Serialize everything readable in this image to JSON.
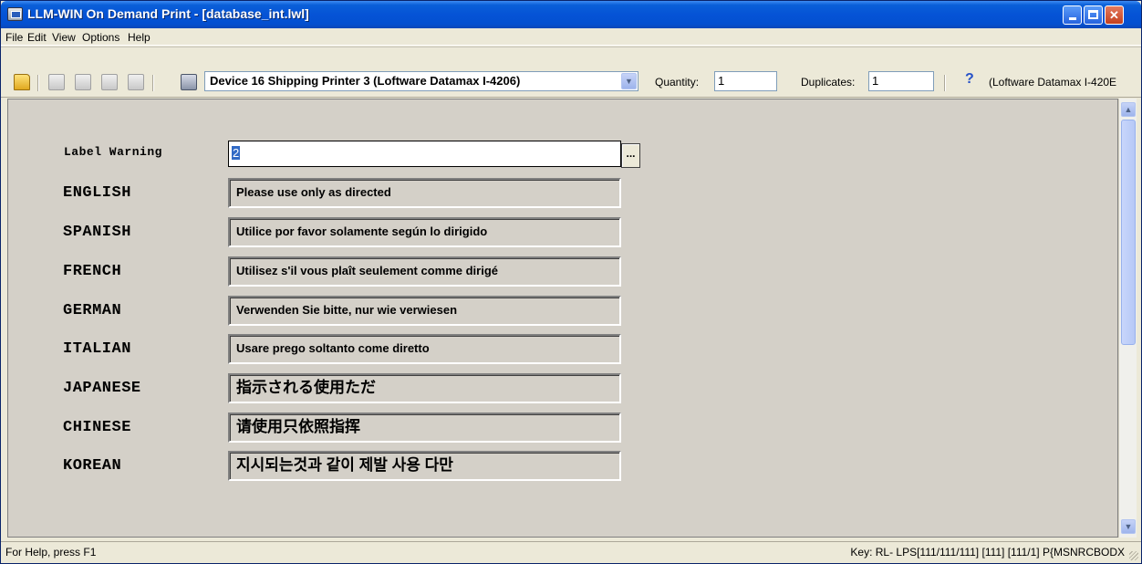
{
  "window": {
    "title": "LLM-WIN On Demand Print - [database_int.lwl]"
  },
  "menu": {
    "file": "File",
    "edit": "Edit",
    "view": "View",
    "options": "Options",
    "help": "Help"
  },
  "toolbar": {
    "device": "Device 16 Shipping Printer 3 (Loftware Datamax I-4206)",
    "quantity_label": "Quantity:",
    "quantity_value": "1",
    "duplicates_label": "Duplicates:",
    "duplicates_value": "1",
    "help_symbol": "?",
    "printer_info": "(Loftware Datamax I-420E"
  },
  "form": {
    "label_warning": {
      "label": "Label Warning",
      "value": "2",
      "browse": "..."
    },
    "rows": [
      {
        "label": "ENGLISH",
        "text": "Please use only as directed"
      },
      {
        "label": "SPANISH",
        "text": "Utilice por favor solamente según lo dirigido"
      },
      {
        "label": "FRENCH",
        "text": "Utilisez s'il vous plaît seulement comme dirigé"
      },
      {
        "label": "GERMAN",
        "text": "Verwenden Sie bitte, nur wie verwiesen"
      },
      {
        "label": "ITALIAN",
        "text": "Usare prego soltanto come diretto"
      },
      {
        "label": "JAPANESE",
        "text": "指示される使用ただ"
      },
      {
        "label": "CHINESE",
        "text": "请使用只依照指挥"
      },
      {
        "label": "KOREAN",
        "text": "지시되는것과 같이 제발 사용 다만"
      }
    ]
  },
  "status": {
    "left": "For Help, press F1",
    "right": "Key: RL- LPS[111/111/111] [111] [111/1]  P{MSNRCBODX"
  },
  "icons": {
    "open": "folder-open-icon",
    "save": "save-icon",
    "print": "printer-icon",
    "dropdown": "chevron-down-icon"
  }
}
